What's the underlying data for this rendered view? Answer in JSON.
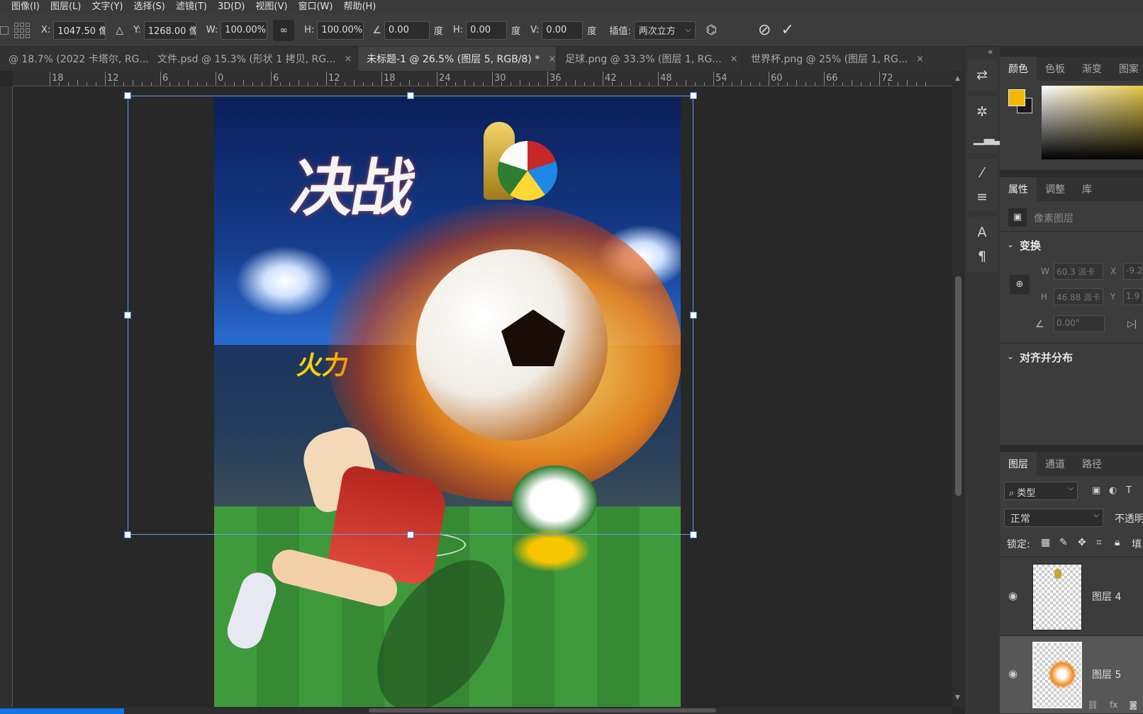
{
  "menu": [
    "图像(I)",
    "图层(L)",
    "文字(Y)",
    "选择(S)",
    "滤镜(T)",
    "3D(D)",
    "视图(V)",
    "窗口(W)",
    "帮助(H)"
  ],
  "options": {
    "x_label": "X:",
    "x_value": "1047.50 像",
    "y_label": "Y:",
    "y_value": "1268.00 像",
    "w_label": "W:",
    "w_value": "100.00%",
    "h_label": "H:",
    "h_value": "100.00%",
    "angle_value": "0.00",
    "angle_unit": "度",
    "hskew_label": "H:",
    "hskew_value": "0.00",
    "hskew_unit": "度",
    "vskew_label": "V:",
    "vskew_value": "0.00",
    "vskew_unit": "度",
    "interp_label": "插值:",
    "interp_value": "两次立方"
  },
  "tabs": [
    {
      "label": "@ 18.7% (2022  卡塔尔, RG...",
      "close": "×"
    },
    {
      "label": "文件.psd @ 15.3% (形状 1 拷贝, RG...",
      "close": "×"
    },
    {
      "label": "未标题-1 @ 26.5% (图层 5, RGB/8) *",
      "close": "×",
      "active": true
    },
    {
      "label": "足球.png @ 33.3% (图层 1, RG...",
      "close": "×"
    },
    {
      "label": "世界杯.png @ 25% (图层 1, RG...",
      "close": "×"
    }
  ],
  "ruler_labels": [
    "18",
    "12",
    "6",
    "0",
    "6",
    "12",
    "18",
    "24",
    "30",
    "36",
    "42",
    "48",
    "54",
    "60",
    "66",
    "72"
  ],
  "poster": {
    "title_line1": "决战",
    "slogan": "火力"
  },
  "color_panel": {
    "tabs": [
      "颜色",
      "色板",
      "渐变",
      "图案"
    ],
    "fg_color": "#f2b800",
    "bg_color": "#1a1a1a"
  },
  "properties_panel": {
    "tabs": [
      "属性",
      "调整",
      "库"
    ],
    "pixel_layer_label": "像素图层",
    "transform_label": "变换",
    "w_label": "W",
    "w_value": "60.3 派卡",
    "x_label": "X",
    "x_value": "-9.2",
    "h_label": "H",
    "h_value": "46.88 派卡",
    "y_label": "Y",
    "y_value": "1.9",
    "angle_value": "0.00°",
    "align_label": "对齐并分布"
  },
  "layers_panel": {
    "tabs": [
      "图层",
      "通道",
      "路径"
    ],
    "filter_label": "类型",
    "blend_mode": "正常",
    "opacity_label": "不透明",
    "lock_label": "锁定:",
    "fill_label": "填",
    "layers": [
      {
        "name": "图层 4",
        "visible": true,
        "selected": false
      },
      {
        "name": "图层 5",
        "visible": true,
        "selected": true
      }
    ],
    "bottom_icons": [
      "link-icon",
      "fx-icon",
      "mask-icon"
    ],
    "fx_label": "fx"
  }
}
